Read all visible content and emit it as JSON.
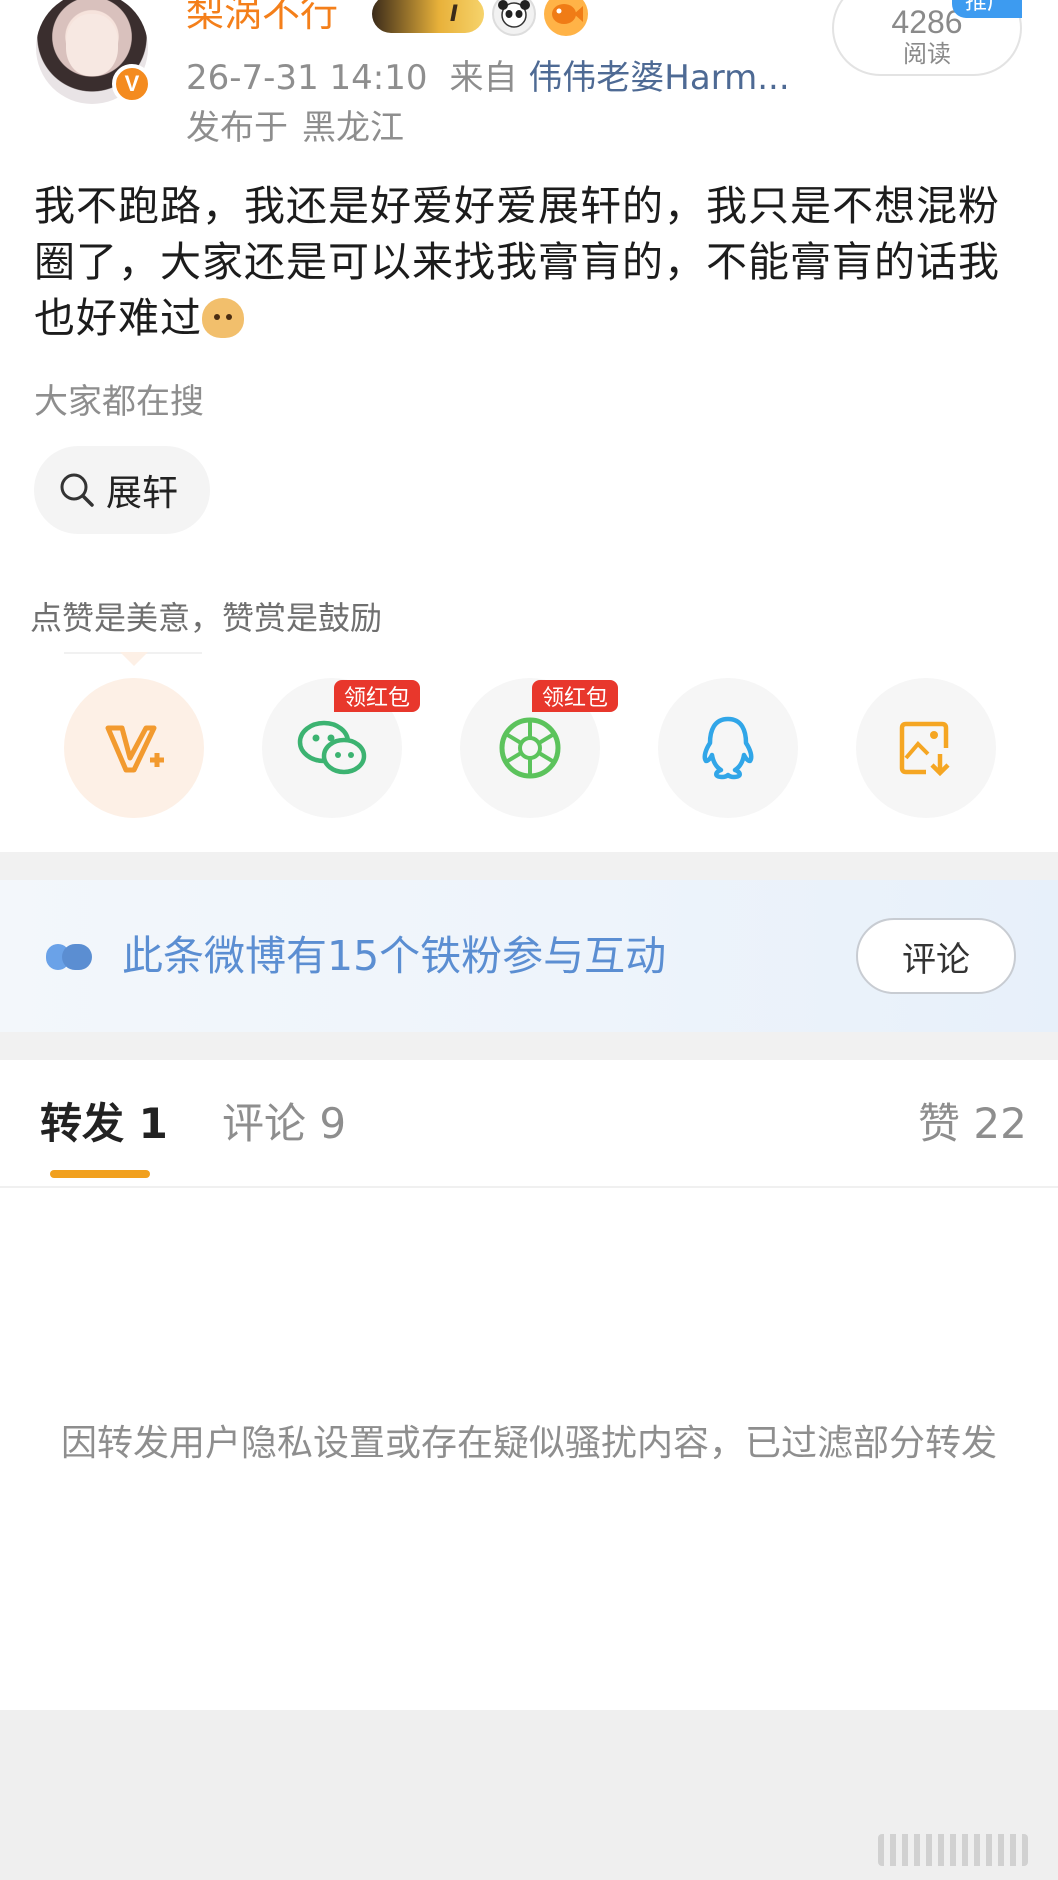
{
  "header": {
    "username": "梨涡不行",
    "member_level": "I",
    "timestamp": "26-7-31 14:10",
    "source_prefix": "来自",
    "source": "伟伟老婆Harm...",
    "location_prefix": "发布于",
    "location": "黑龙江",
    "read_count": "4286",
    "read_label": "阅读",
    "promo_tag": "推广",
    "verified_mark": "V"
  },
  "post": {
    "text": "我不跑路，我还是好爱好爱展轩的，我只是不想混粉圈了，大家还是可以来找我膏肓的，不能膏肓的话我也好难过"
  },
  "search": {
    "hint": "大家都在搜",
    "chip_label": "展轩"
  },
  "reward": {
    "hint": "点赞是美意，赞赏是鼓励"
  },
  "share": {
    "buttons": [
      {
        "icon": "reward-v-plus-icon",
        "color": "#f29a2f"
      },
      {
        "icon": "wechat-icon",
        "color": "#3cb371",
        "tag": "领红包"
      },
      {
        "icon": "moments-icon",
        "color": "#5cc35c",
        "tag": "领红包"
      },
      {
        "icon": "qq-icon",
        "color": "#31a6e8"
      },
      {
        "icon": "save-image-icon",
        "color": "#f5a623"
      }
    ]
  },
  "banner": {
    "text": "此条微博有15个铁粉参与互动",
    "button_label": "评论"
  },
  "tabs": {
    "forward": "转发 1",
    "comment": "评论 9",
    "like": "赞 22"
  },
  "notice": "因转发用户隐私设置或存在疑似骚扰内容，已过滤部分转发",
  "colors": {
    "username": "#f47f1a",
    "source_link": "#4e6a94",
    "banner_text": "#5b8ed2",
    "tab_indicator": "#f1a01e",
    "red_tag": "#e8372c"
  }
}
